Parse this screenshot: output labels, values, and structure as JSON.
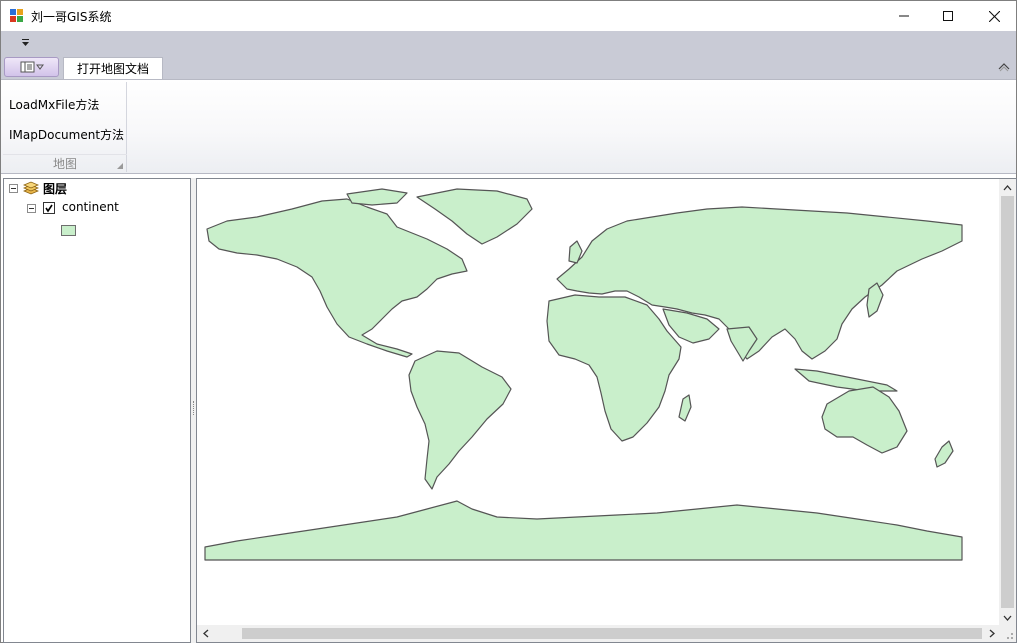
{
  "window": {
    "title": "刘一哥GIS系统",
    "icons": {
      "app": "app-icon",
      "minimize": "minimize-icon",
      "maximize": "maximize-icon",
      "close": "close-icon"
    }
  },
  "ribbon": {
    "tabs": [
      {
        "label": "打开地图文档",
        "active": true
      }
    ],
    "groups": [
      {
        "caption": "地图",
        "buttons": [
          {
            "label": "LoadMxFile方法"
          },
          {
            "label": "IMapDocument方法"
          }
        ]
      }
    ]
  },
  "toc": {
    "root": {
      "label": "图层",
      "icon": "layers-icon",
      "expanded": true
    },
    "layers": [
      {
        "label": "continent",
        "checked": true,
        "symbol_color": "#c9efcb"
      }
    ]
  },
  "map": {
    "land_color": "#c9efcb",
    "outline_color": "#555555",
    "background": "#ffffff"
  },
  "colors": {
    "ribbon_strip": "#c9cbd6",
    "app_button": "#d2c3ea"
  }
}
